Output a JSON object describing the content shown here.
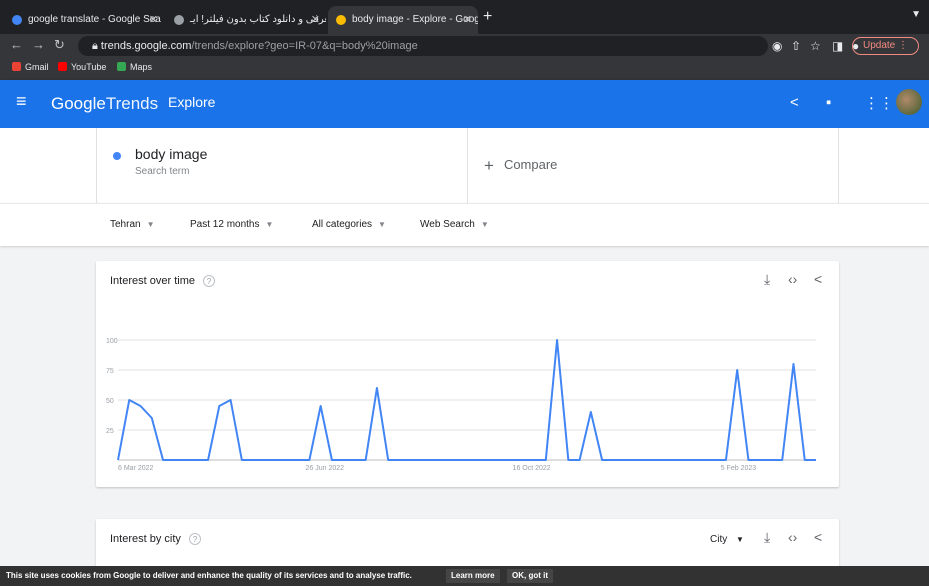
{
  "tabs": [
    {
      "label": "google translate - Google Sea",
      "color": "#4285f4"
    },
    {
      "label": "معرفی و دانلود کتاب بدون فیلتر! ایـ",
      "color": "#9aa0a6"
    },
    {
      "label": "body image - Explore - Googl",
      "color": "#fbbc04"
    }
  ],
  "url": {
    "host": "trends.google.com",
    "path": "/trends/explore?geo=IR-07&q=body%20image"
  },
  "update_label": "Update",
  "bookmarks": [
    {
      "label": "Gmail",
      "color": "#ea4335"
    },
    {
      "label": "YouTube",
      "color": "#ff0000"
    },
    {
      "label": "Maps",
      "color": "#34a853"
    }
  ],
  "appbar": {
    "logo_google": "Google",
    "logo_trends": "Trends",
    "section": "Explore"
  },
  "search": {
    "term": "body image",
    "term_type": "Search term",
    "compare": "Compare"
  },
  "filters": {
    "region": "Tehran",
    "period": "Past 12 months",
    "category": "All categories",
    "search_type": "Web Search"
  },
  "card1": {
    "title": "Interest over time"
  },
  "card2": {
    "title": "Interest by city",
    "resolution": "City"
  },
  "chart_data": {
    "type": "line",
    "title": "Interest over time",
    "ylim": [
      0,
      100
    ],
    "yticks": [
      "100",
      "75",
      "50",
      "25"
    ],
    "xtick_labels": [
      "6 Mar 2022",
      "26 Jun 2022",
      "16 Oct 2022",
      "5 Feb 2023"
    ],
    "xtick_index": [
      0,
      16,
      32,
      48
    ],
    "series": [
      {
        "color": "#4285f4",
        "values": [
          0,
          50,
          45,
          35,
          0,
          0,
          0,
          0,
          0,
          45,
          50,
          0,
          0,
          0,
          0,
          0,
          0,
          0,
          45,
          0,
          0,
          0,
          0,
          60,
          0,
          0,
          0,
          0,
          0,
          0,
          0,
          0,
          0,
          0,
          0,
          0,
          0,
          0,
          0,
          100,
          0,
          0,
          40,
          0,
          0,
          0,
          0,
          0,
          0,
          0,
          0,
          0,
          0,
          0,
          0,
          75,
          0,
          0,
          0,
          0,
          80,
          0,
          0
        ]
      }
    ]
  },
  "cookie": {
    "text": "This site uses cookies from Google to deliver and enhance the quality of its services and to analyse traffic.",
    "learn_more": "Learn more",
    "ok": "OK, got it"
  }
}
